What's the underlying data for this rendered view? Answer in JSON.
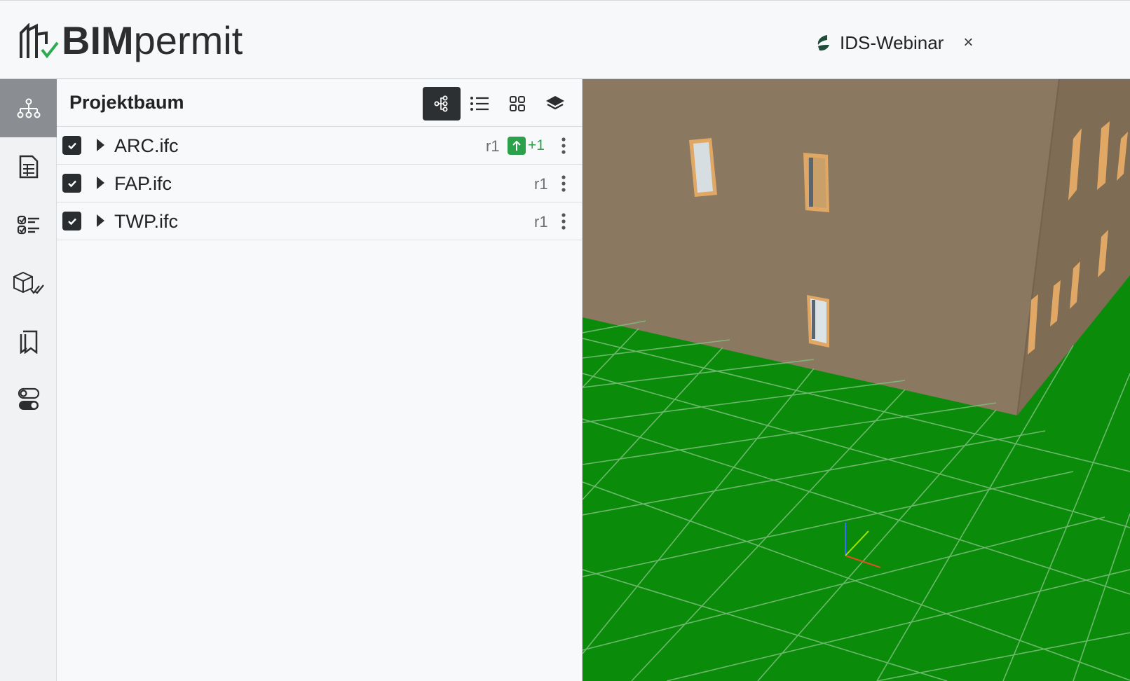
{
  "header": {
    "logo_bim": "BIM",
    "logo_permit": "permit",
    "project_name": "IDS-Webinar",
    "close_label": "×"
  },
  "rail": {
    "items": [
      {
        "icon": "hierarchy-icon",
        "active": true
      },
      {
        "icon": "document-icon",
        "active": false
      },
      {
        "icon": "checklist-icon",
        "active": false
      },
      {
        "icon": "cube-check-icon",
        "active": false
      },
      {
        "icon": "bookmarks-icon",
        "active": false
      },
      {
        "icon": "toggles-icon",
        "active": false
      }
    ]
  },
  "panel": {
    "title": "Projektbaum",
    "view_toggles": [
      "tree-view-icon",
      "list-view-icon",
      "grid-view-icon",
      "layers-icon"
    ],
    "files": [
      {
        "name": "ARC.ifc",
        "revision": "r1",
        "update": "+1",
        "checked": true
      },
      {
        "name": "FAP.ifc",
        "revision": "r1",
        "checked": true
      },
      {
        "name": "TWP.ifc",
        "revision": "r1",
        "checked": true
      }
    ]
  },
  "colors": {
    "accent_dark": "#2d3033",
    "update_green": "#2aa14a",
    "ground_green": "#0a8c0a",
    "wall_brown": "#8b7860"
  }
}
